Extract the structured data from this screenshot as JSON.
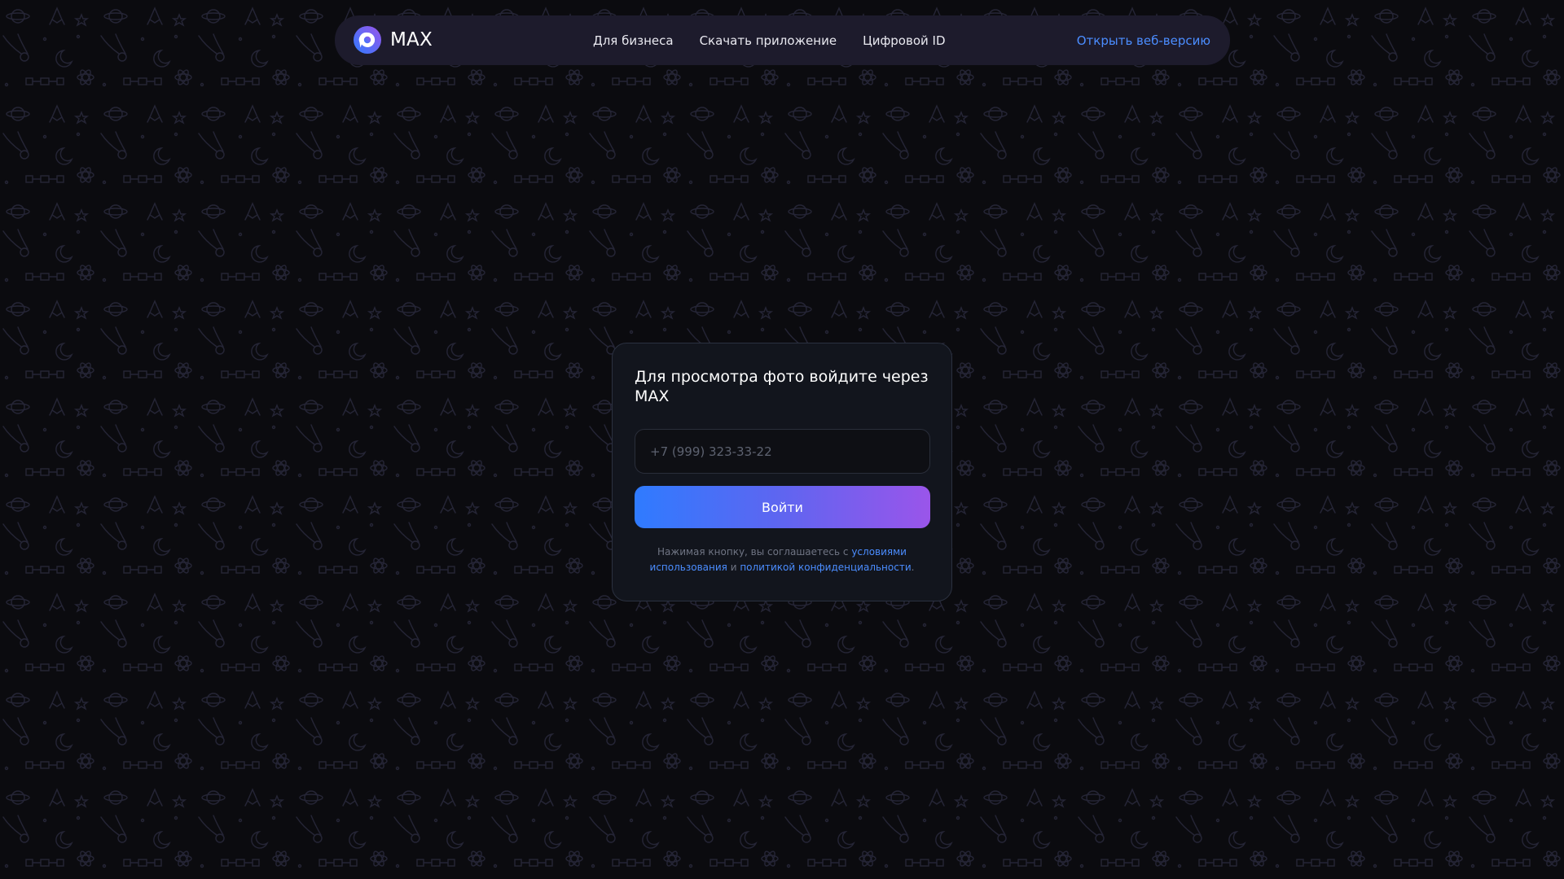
{
  "header": {
    "logo_text": "MAX",
    "nav": [
      {
        "label": "Для бизнеса"
      },
      {
        "label": "Скачать приложение"
      },
      {
        "label": "Цифровой ID"
      }
    ],
    "open_web_label": "Открыть веб-версию"
  },
  "login_card": {
    "title": "Для просмотра фото войдите через MAX",
    "phone_placeholder": "+7 (999) 323-33-22",
    "phone_value": "",
    "submit_label": "Войти",
    "legal": {
      "prefix": "Нажимая кнопку, вы соглашаетесь с",
      "terms_link": "условиями использования",
      "conjunction": "и",
      "privacy_link": "политикой конфиденциальности",
      "suffix": "."
    }
  },
  "colors": {
    "page_background": "#0b0b0f",
    "header_background": "#1d1b2c",
    "card_background": "#12151d",
    "link": "#4b8dff",
    "button_gradient_start": "#2f7bff",
    "button_gradient_end": "#9a55ea",
    "pattern_stroke": "#252536"
  },
  "icons": {
    "logo": "max-logo-icon",
    "background": "space-doodle-pattern"
  }
}
